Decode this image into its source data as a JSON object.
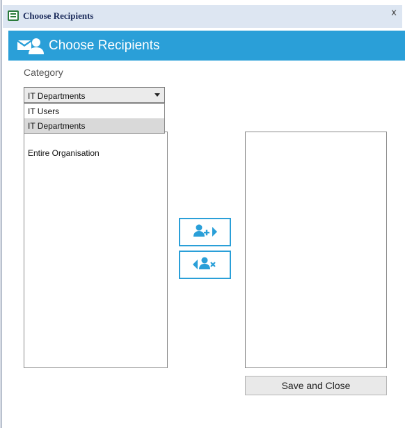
{
  "window": {
    "title": "Choose Recipients",
    "close_glyph": "x",
    "icon": "form-icon"
  },
  "header": {
    "title": "Choose Recipients",
    "icon": "people-icon",
    "color": "#2a9fd8"
  },
  "category": {
    "label": "Category",
    "selected_value": "IT Departments",
    "options": [
      {
        "label": "IT Users",
        "selected": false
      },
      {
        "label": "IT Departments",
        "selected": true
      }
    ]
  },
  "available_list": {
    "items": [
      "Entire Organisation"
    ]
  },
  "selected_list": {
    "items": []
  },
  "buttons": {
    "add_icon": "add-user-arrow-right-icon",
    "remove_icon": "remove-user-arrow-left-icon",
    "save_label": "Save and Close"
  },
  "colors": {
    "accent": "#2a9fd8",
    "titlebar": "#dde6f2"
  }
}
